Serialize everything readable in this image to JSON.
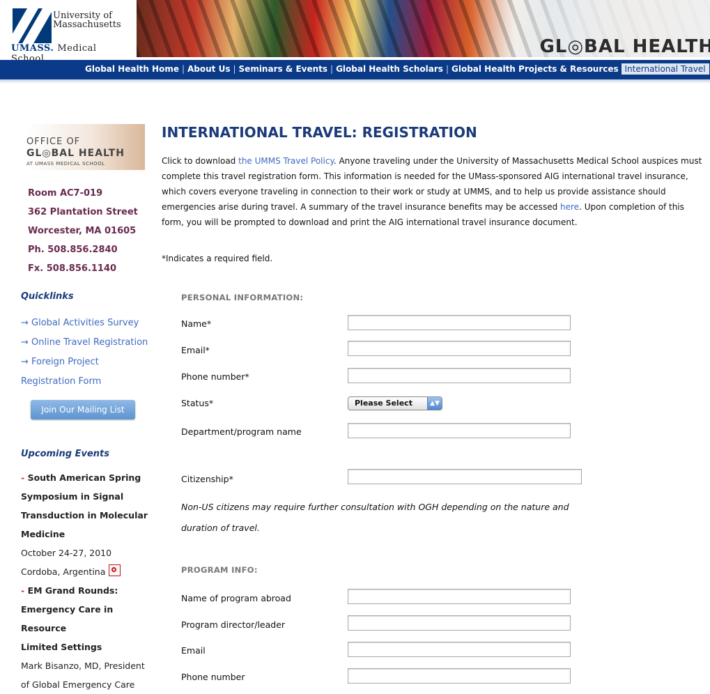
{
  "header": {
    "logo_line1": "University of",
    "logo_line2": "Massachusetts",
    "logo_umass": "UMASS.",
    "logo_school": "Medical School",
    "banner_title": "GL◎BAL HEALTH"
  },
  "nav": {
    "items": [
      "Global Health Home",
      "About Us",
      "Seminars & Events",
      "Global Health Scholars",
      "Global Health Projects & Resources"
    ],
    "active": "International Travel",
    "separator": "|"
  },
  "sidebar": {
    "ogh_logo": {
      "line1": "OFFICE OF",
      "line2": "GL◎BAL HEALTH",
      "line3": "AT UMASS MEDICAL SCHOOL"
    },
    "address": [
      "Room AC7-019",
      "362 Plantation Street",
      "Worcester, MA 01605",
      "Ph. 508.856.2840",
      "Fx. 508.856.1140"
    ],
    "quicklinks_heading": "Quicklinks",
    "quicklinks": [
      "→ Global Activities Survey",
      "→ Online Travel Registration",
      "→ Foreign Project",
      "Registration Form"
    ],
    "mailing_button": "Join Our Mailing List",
    "events_heading": "Upcoming Events",
    "events": {
      "dash": "-",
      "e1_title": [
        "South American Spring",
        "Symposium in Signal",
        "Transduction in Molecular",
        "Medicine"
      ],
      "e1_date": "October 24-27, 2010",
      "e1_location": "Cordoba, Argentina",
      "e2_title": [
        "EM Grand Rounds:",
        "Emergency Care in Resource",
        "Limited Settings"
      ],
      "e2_speaker": [
        "Mark Bisanzo, MD, President",
        "of Global Emergency Care"
      ]
    }
  },
  "main": {
    "title": "INTERNATIONAL TRAVEL: REGISTRATION",
    "intro": {
      "l1_a": "Click to download ",
      "l1_link": "the UMMS Travel Policy",
      "l1_b": ". Anyone traveling under the University of Massachusetts Medical School auspices must",
      "l2": "complete this travel registration form. This information is needed for the UMass-sponsored AIG international travel insurance,",
      "l3": "which covers everyone traveling in connection to their work or study at UMMS, and to help us provide assistance should",
      "l4_a": "emergencies arise during travel. A summary of the travel insurance benefits may be accessed ",
      "l4_link": "here",
      "l4_b": ". Upon completion of this",
      "l5": "form, you will be prompted to download and print the AIG international travel insurance document."
    },
    "required_note": "*Indicates a required field.",
    "personal_heading": "PERSONAL INFORMATION:",
    "personal_fields": {
      "name": {
        "label": "Name*",
        "value": ""
      },
      "email": {
        "label": "Email*",
        "value": ""
      },
      "phone": {
        "label": "Phone number*",
        "value": ""
      },
      "status": {
        "label": "Status*",
        "selected": "Please Select"
      },
      "department": {
        "label": "Department/program name",
        "value": ""
      },
      "citizenship": {
        "label": "Citizenship*",
        "value": ""
      }
    },
    "citizenship_note": "Non-US citizens may require further consultation with OGH depending on the nature and duration of travel.",
    "program_heading": "PROGRAM INFO:",
    "program_fields": {
      "name": {
        "label": "Name of program abroad",
        "value": ""
      },
      "director": {
        "label": "Program director/leader",
        "value": ""
      },
      "email": {
        "label": "Email",
        "value": ""
      },
      "phone": {
        "label": "Phone number",
        "value": ""
      }
    }
  }
}
